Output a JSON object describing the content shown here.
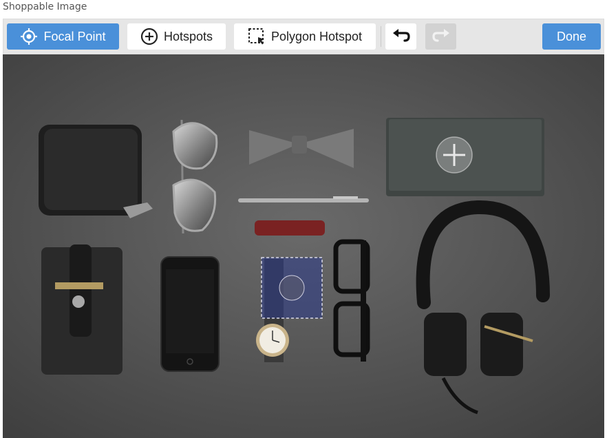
{
  "window": {
    "title": "Shoppable Image"
  },
  "toolbar": {
    "focal_point_label": "Focal Point",
    "hotspots_label": "Hotspots",
    "polygon_hotspot_label": "Polygon Hotspot",
    "done_label": "Done",
    "undo_icon": "undo-icon",
    "redo_icon": "redo-icon",
    "redo_enabled": false
  },
  "colors": {
    "primary": "#4a90d9",
    "toolbar_bg": "#e6e6e6",
    "photo_bg": "#545454",
    "polygon_fill": "#2c3b8a"
  }
}
